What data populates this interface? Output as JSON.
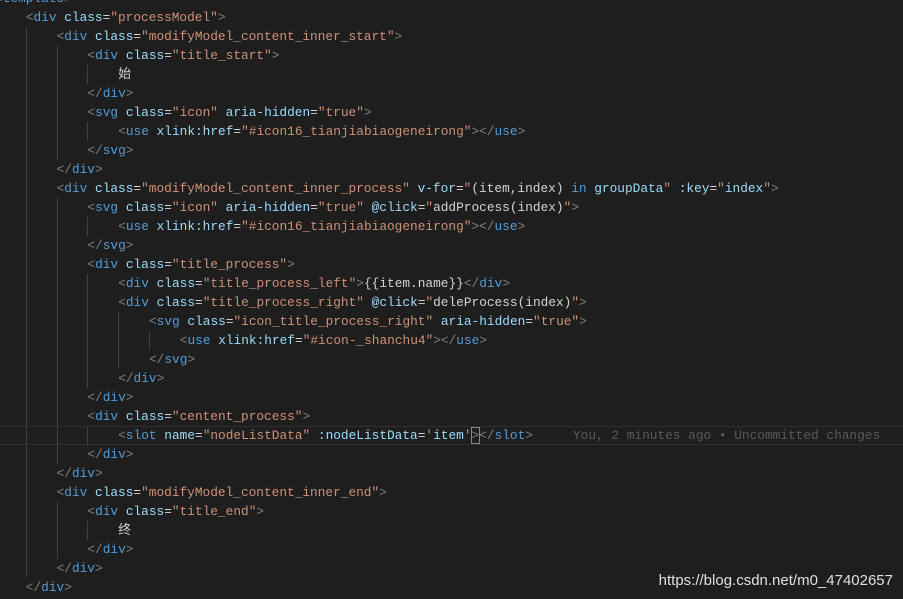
{
  "editor": {
    "lines": [
      {
        "indent": 0,
        "tokens": [
          [
            "p",
            "<"
          ],
          [
            "t",
            "template"
          ],
          [
            "p",
            ">"
          ]
        ]
      },
      {
        "indent": 1,
        "tokens": [
          [
            "p",
            "<"
          ],
          [
            "t",
            "div"
          ],
          [
            "x",
            " "
          ],
          [
            "a",
            "class"
          ],
          [
            "x",
            "="
          ],
          [
            "s",
            "\"processModel\""
          ],
          [
            "p",
            ">"
          ]
        ]
      },
      {
        "indent": 2,
        "tokens": [
          [
            "p",
            "<"
          ],
          [
            "t",
            "div"
          ],
          [
            "x",
            " "
          ],
          [
            "a",
            "class"
          ],
          [
            "x",
            "="
          ],
          [
            "s",
            "\"modifyModel_content_inner_start\""
          ],
          [
            "p",
            ">"
          ]
        ]
      },
      {
        "indent": 3,
        "tokens": [
          [
            "p",
            "<"
          ],
          [
            "t",
            "div"
          ],
          [
            "x",
            " "
          ],
          [
            "a",
            "class"
          ],
          [
            "x",
            "="
          ],
          [
            "s",
            "\"title_start\""
          ],
          [
            "p",
            ">"
          ]
        ]
      },
      {
        "indent": 4,
        "tokens": [
          [
            "x",
            "始"
          ]
        ]
      },
      {
        "indent": 3,
        "tokens": [
          [
            "p",
            "</"
          ],
          [
            "t",
            "div"
          ],
          [
            "p",
            ">"
          ]
        ]
      },
      {
        "indent": 3,
        "tokens": [
          [
            "p",
            "<"
          ],
          [
            "t",
            "svg"
          ],
          [
            "x",
            " "
          ],
          [
            "a",
            "class"
          ],
          [
            "x",
            "="
          ],
          [
            "s",
            "\"icon\""
          ],
          [
            "x",
            " "
          ],
          [
            "a",
            "aria-hidden"
          ],
          [
            "x",
            "="
          ],
          [
            "s",
            "\"true\""
          ],
          [
            "p",
            ">"
          ]
        ]
      },
      {
        "indent": 4,
        "tokens": [
          [
            "p",
            "<"
          ],
          [
            "t",
            "use"
          ],
          [
            "x",
            " "
          ],
          [
            "a",
            "xlink:href"
          ],
          [
            "x",
            "="
          ],
          [
            "s",
            "\"#icon16_tianjiabiaogeneirong\""
          ],
          [
            "p",
            "></"
          ],
          [
            "t",
            "use"
          ],
          [
            "p",
            ">"
          ]
        ]
      },
      {
        "indent": 3,
        "tokens": [
          [
            "p",
            "</"
          ],
          [
            "t",
            "svg"
          ],
          [
            "p",
            ">"
          ]
        ]
      },
      {
        "indent": 2,
        "tokens": [
          [
            "p",
            "</"
          ],
          [
            "t",
            "div"
          ],
          [
            "p",
            ">"
          ]
        ]
      },
      {
        "indent": 2,
        "tokens": [
          [
            "p",
            "<"
          ],
          [
            "t",
            "div"
          ],
          [
            "x",
            " "
          ],
          [
            "a",
            "class"
          ],
          [
            "x",
            "="
          ],
          [
            "s",
            "\"modifyModel_content_inner_process\""
          ],
          [
            "x",
            " "
          ],
          [
            "a",
            "v-for"
          ],
          [
            "x",
            "="
          ],
          [
            "s",
            "\""
          ],
          [
            "x",
            "(item,index) "
          ],
          [
            "k",
            "in"
          ],
          [
            "x",
            " "
          ],
          [
            "v",
            "groupData"
          ],
          [
            "s",
            "\""
          ],
          [
            "x",
            " "
          ],
          [
            "a",
            ":key"
          ],
          [
            "x",
            "="
          ],
          [
            "s",
            "\""
          ],
          [
            "v",
            "index"
          ],
          [
            "s",
            "\""
          ],
          [
            "p",
            ">"
          ]
        ]
      },
      {
        "indent": 3,
        "tokens": [
          [
            "p",
            "<"
          ],
          [
            "t",
            "svg"
          ],
          [
            "x",
            " "
          ],
          [
            "a",
            "class"
          ],
          [
            "x",
            "="
          ],
          [
            "s",
            "\"icon\""
          ],
          [
            "x",
            " "
          ],
          [
            "a",
            "aria-hidden"
          ],
          [
            "x",
            "="
          ],
          [
            "s",
            "\"true\""
          ],
          [
            "x",
            " "
          ],
          [
            "a",
            "@click"
          ],
          [
            "x",
            "="
          ],
          [
            "s",
            "\""
          ],
          [
            "x",
            "addProcess(index)"
          ],
          [
            "s",
            "\""
          ],
          [
            "p",
            ">"
          ]
        ]
      },
      {
        "indent": 4,
        "tokens": [
          [
            "p",
            "<"
          ],
          [
            "t",
            "use"
          ],
          [
            "x",
            " "
          ],
          [
            "a",
            "xlink:href"
          ],
          [
            "x",
            "="
          ],
          [
            "s",
            "\"#icon16_tianjiabiaogeneirong\""
          ],
          [
            "p",
            "></"
          ],
          [
            "t",
            "use"
          ],
          [
            "p",
            ">"
          ]
        ]
      },
      {
        "indent": 3,
        "tokens": [
          [
            "p",
            "</"
          ],
          [
            "t",
            "svg"
          ],
          [
            "p",
            ">"
          ]
        ]
      },
      {
        "indent": 3,
        "tokens": [
          [
            "p",
            "<"
          ],
          [
            "t",
            "div"
          ],
          [
            "x",
            " "
          ],
          [
            "a",
            "class"
          ],
          [
            "x",
            "="
          ],
          [
            "s",
            "\"title_process\""
          ],
          [
            "p",
            ">"
          ]
        ]
      },
      {
        "indent": 4,
        "tokens": [
          [
            "p",
            "<"
          ],
          [
            "t",
            "div"
          ],
          [
            "x",
            " "
          ],
          [
            "a",
            "class"
          ],
          [
            "x",
            "="
          ],
          [
            "s",
            "\"title_process_left\""
          ],
          [
            "p",
            ">"
          ],
          [
            "x",
            "{{item.name}}"
          ],
          [
            "p",
            "</"
          ],
          [
            "t",
            "div"
          ],
          [
            "p",
            ">"
          ]
        ]
      },
      {
        "indent": 4,
        "tokens": [
          [
            "p",
            "<"
          ],
          [
            "t",
            "div"
          ],
          [
            "x",
            " "
          ],
          [
            "a",
            "class"
          ],
          [
            "x",
            "="
          ],
          [
            "s",
            "\"title_process_right\""
          ],
          [
            "x",
            " "
          ],
          [
            "a",
            "@click"
          ],
          [
            "x",
            "="
          ],
          [
            "s",
            "\""
          ],
          [
            "x",
            "deleProcess(index)"
          ],
          [
            "s",
            "\""
          ],
          [
            "p",
            ">"
          ]
        ]
      },
      {
        "indent": 5,
        "tokens": [
          [
            "p",
            "<"
          ],
          [
            "t",
            "svg"
          ],
          [
            "x",
            " "
          ],
          [
            "a",
            "class"
          ],
          [
            "x",
            "="
          ],
          [
            "s",
            "\"icon_title_process_right\""
          ],
          [
            "x",
            " "
          ],
          [
            "a",
            "aria-hidden"
          ],
          [
            "x",
            "="
          ],
          [
            "s",
            "\"true\""
          ],
          [
            "p",
            ">"
          ]
        ]
      },
      {
        "indent": 6,
        "tokens": [
          [
            "p",
            "<"
          ],
          [
            "t",
            "use"
          ],
          [
            "x",
            " "
          ],
          [
            "a",
            "xlink:href"
          ],
          [
            "x",
            "="
          ],
          [
            "s",
            "\"#icon-_shanchu4\""
          ],
          [
            "p",
            "></"
          ],
          [
            "t",
            "use"
          ],
          [
            "p",
            ">"
          ]
        ]
      },
      {
        "indent": 5,
        "tokens": [
          [
            "p",
            "</"
          ],
          [
            "t",
            "svg"
          ],
          [
            "p",
            ">"
          ]
        ]
      },
      {
        "indent": 4,
        "tokens": [
          [
            "p",
            "</"
          ],
          [
            "t",
            "div"
          ],
          [
            "p",
            ">"
          ]
        ]
      },
      {
        "indent": 3,
        "tokens": [
          [
            "p",
            "</"
          ],
          [
            "t",
            "div"
          ],
          [
            "p",
            ">"
          ]
        ]
      },
      {
        "indent": 3,
        "tokens": [
          [
            "p",
            "<"
          ],
          [
            "t",
            "div"
          ],
          [
            "x",
            " "
          ],
          [
            "a",
            "class"
          ],
          [
            "x",
            "="
          ],
          [
            "s",
            "\"centent_process\""
          ],
          [
            "p",
            ">"
          ]
        ]
      },
      {
        "indent": 4,
        "current": true,
        "blame": "You, 2 minutes ago • Uncommitted changes",
        "tokens": [
          [
            "p",
            "<"
          ],
          [
            "t",
            "slot"
          ],
          [
            "x",
            " "
          ],
          [
            "a",
            "name"
          ],
          [
            "x",
            "="
          ],
          [
            "s",
            "\"nodeListData\""
          ],
          [
            "x",
            " "
          ],
          [
            "a",
            ":nodeListData"
          ],
          [
            "x",
            "="
          ],
          [
            "s",
            "'"
          ],
          [
            "v",
            "item"
          ],
          [
            "s",
            "'"
          ],
          [
            "p",
            ">",
            "cursor"
          ],
          [
            "p",
            "</"
          ],
          [
            "t",
            "slot"
          ],
          [
            "p",
            ">"
          ]
        ]
      },
      {
        "indent": 3,
        "tokens": [
          [
            "p",
            "</"
          ],
          [
            "t",
            "div"
          ],
          [
            "p",
            ">"
          ]
        ]
      },
      {
        "indent": 2,
        "tokens": [
          [
            "p",
            "</"
          ],
          [
            "t",
            "div"
          ],
          [
            "p",
            ">"
          ]
        ]
      },
      {
        "indent": 2,
        "tokens": [
          [
            "p",
            "<"
          ],
          [
            "t",
            "div"
          ],
          [
            "x",
            " "
          ],
          [
            "a",
            "class"
          ],
          [
            "x",
            "="
          ],
          [
            "s",
            "\"modifyModel_content_inner_end\""
          ],
          [
            "p",
            ">"
          ]
        ]
      },
      {
        "indent": 3,
        "tokens": [
          [
            "p",
            "<"
          ],
          [
            "t",
            "div"
          ],
          [
            "x",
            " "
          ],
          [
            "a",
            "class"
          ],
          [
            "x",
            "="
          ],
          [
            "s",
            "\"title_end\""
          ],
          [
            "p",
            ">"
          ]
        ]
      },
      {
        "indent": 4,
        "tokens": [
          [
            "x",
            "终"
          ]
        ]
      },
      {
        "indent": 3,
        "tokens": [
          [
            "p",
            "</"
          ],
          [
            "t",
            "div"
          ],
          [
            "p",
            ">"
          ]
        ]
      },
      {
        "indent": 2,
        "tokens": [
          [
            "p",
            "</"
          ],
          [
            "t",
            "div"
          ],
          [
            "p",
            ">"
          ]
        ]
      },
      {
        "indent": 1,
        "tokens": [
          [
            "p",
            "</"
          ],
          [
            "t",
            "div"
          ],
          [
            "p",
            ">"
          ]
        ]
      }
    ]
  },
  "watermark": "https://blog.csdn.net/m0_47402657"
}
